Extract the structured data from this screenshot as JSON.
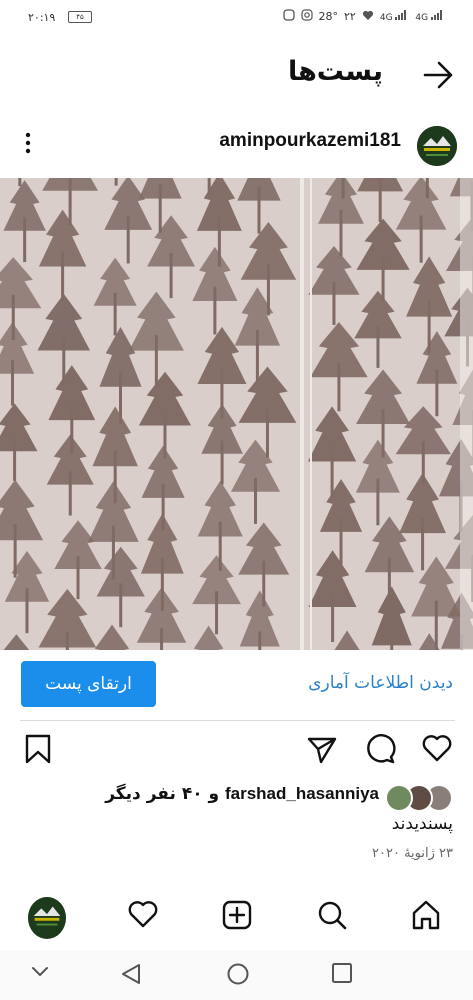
{
  "status_bar": {
    "time": "۲۰:۱۹",
    "battery": "۴۵",
    "temperature": "28°",
    "notification_count": "۲۲",
    "signal_1": "4G",
    "signal_2": "4G"
  },
  "header": {
    "title": "پست‌ها"
  },
  "post": {
    "username": "aminpourkazemi181",
    "promote_label": "ارتقای پست",
    "insights_label": "دیدن اطلاعات آماری",
    "liked_by_user": "farshad_hasanniya",
    "liked_by_others": " و ۴۰ نفر دیگر",
    "liked_suffix": "پسندیدند",
    "date": "۲۳ ژانویهٔ ۲۰۲۰"
  },
  "icons": {
    "back": "arrow-right-icon",
    "more": "more-vertical-icon",
    "like": "heart-icon",
    "comment": "comment-icon",
    "share": "send-icon",
    "save": "bookmark-icon",
    "nav_home": "home-icon",
    "nav_search": "search-icon",
    "nav_add": "add-post-icon",
    "nav_activity": "heart-icon",
    "sys_back": "triangle-back-icon",
    "sys_home": "circle-home-icon",
    "sys_recent": "square-recent-icon",
    "sys_down": "chevron-down-icon"
  },
  "colors": {
    "accent": "#1a8eea",
    "link": "#2b82cc",
    "tree": "#7f6a64",
    "photo_bg": "#d9cec9"
  }
}
